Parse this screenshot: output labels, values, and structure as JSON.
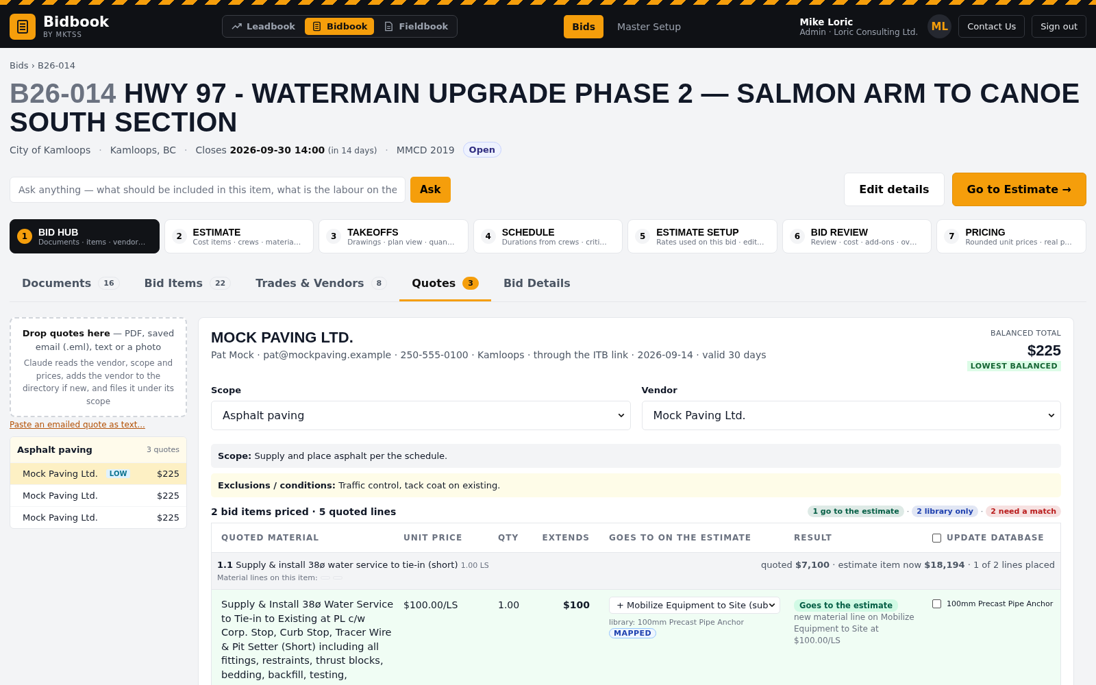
{
  "header": {
    "logo": {
      "name": "Bidbook",
      "sub": "BY MKTSS"
    },
    "apps": [
      {
        "label": "Leadbook",
        "kind": "trend",
        "selected": false
      },
      {
        "label": "Bidbook",
        "kind": "book",
        "selected": true
      },
      {
        "label": "Fieldbook",
        "kind": "doc",
        "selected": false
      }
    ],
    "nav": [
      {
        "label": "Bids",
        "selected": true
      },
      {
        "label": "Master Setup",
        "selected": false
      }
    ],
    "user": {
      "name": "Mike Loric",
      "role": "Admin · Loric Consulting Ltd.",
      "initials": "ML"
    },
    "buttons": [
      "Contact Us",
      "Sign out"
    ]
  },
  "breadcrumb": "Bids › B26-014",
  "title": {
    "code": "B26-014",
    "name": "HWY 97 - WATERMAIN UPGRADE PHASE 2 — SALMON ARM TO CANOE SOUTH SECTION"
  },
  "meta": {
    "client": "City of Kamloops",
    "location": "Kamloops, BC",
    "closes": "Closes **2026-09-30 14:00**",
    "closes_note": "(in 14 days)",
    "standard": "MMCD 2019",
    "status": "Open",
    "separator": "·"
  },
  "ask": {
    "placeholder": "Ask anything — what should be included in this item, what is the labour on the",
    "button": "Ask"
  },
  "actions": [
    {
      "label": "Edit details",
      "kind": "secondary"
    },
    {
      "label": "Go to Estimate →",
      "kind": "primary"
    }
  ],
  "steps": [
    {
      "number": "1",
      "title": "BID HUB",
      "subtitle": "Documents · items · vendor…",
      "selected": true
    },
    {
      "number": "2",
      "title": "ESTIMATE",
      "subtitle": "Cost items · crews · materia…",
      "selected": false
    },
    {
      "number": "3",
      "title": "TAKEOFFS",
      "subtitle": "Drawings · plan view · quan…",
      "selected": false
    },
    {
      "number": "4",
      "title": "SCHEDULE",
      "subtitle": "Durations from crews · criti…",
      "selected": false
    },
    {
      "number": "5",
      "title": "ESTIMATE SETUP",
      "subtitle": "Rates used on this bid · edit…",
      "selected": false
    },
    {
      "number": "6",
      "title": "BID REVIEW",
      "subtitle": "Review · cost · add-ons · ov…",
      "selected": false
    },
    {
      "number": "7",
      "title": "PRICING",
      "subtitle": "Rounded unit prices · real p…",
      "selected": false
    }
  ],
  "tabs": [
    {
      "label": "Documents",
      "count": "16",
      "selected": false
    },
    {
      "label": "Bid Items",
      "count": "22",
      "selected": false
    },
    {
      "label": "Trades & Vendors",
      "count": "8",
      "selected": false
    },
    {
      "label": "Quotes",
      "count": "3",
      "selected": true
    },
    {
      "label": "Bid Details",
      "selected": false
    }
  ],
  "drop": {
    "text": "**Drop quotes here** — PDF, saved email (.eml), text or a photo",
    "note": "Claude reads the vendor, scope and prices, adds the vendor to the directory if new, and files it under its scope",
    "link": "Paste an emailed quote as text..."
  },
  "scope_group": {
    "title": "Asphalt paving",
    "count": "3 quotes",
    "quotes": [
      {
        "vendor": "Mock Paving Ltd.",
        "badge": "LOW",
        "amount": "$225",
        "selected": true
      },
      {
        "vendor": "Mock Paving Ltd.",
        "amount": "$225",
        "selected": false
      },
      {
        "vendor": "Mock Paving Ltd.",
        "amount": "$225",
        "selected": false
      }
    ]
  },
  "quote": {
    "vendor": "MOCK PAVING LTD.",
    "contact": "Pat Mock · pat@mockpaving.example · 250-555-0100 · Kamloops · through the ITB link · 2026-09-14 · valid 30 days",
    "total_label": "BALANCED TOTAL",
    "total": "$225",
    "total_badge": "LOWEST BALANCED",
    "scope_field": {
      "label": "Scope",
      "value": "Asphalt paving"
    },
    "vendor_field": {
      "label": "Vendor",
      "value": "Mock Paving Ltd."
    },
    "scope_note": "**Scope:** Supply and place asphalt per the schedule.",
    "exclusions": "**Exclusions / conditions:** Traffic control, tack coat on existing.",
    "summary": "2 bid items priced · 5 quoted lines",
    "chip_separator": "·",
    "chips": [
      {
        "label": "1 go to the estimate",
        "color": "#065f46"
      },
      {
        "label": "2 library only",
        "color": "#1e40af"
      },
      {
        "label": "2 need a match",
        "color": "#b91c1c"
      }
    ],
    "columns": [
      "QUOTED MATERIAL",
      "UNIT PRICE",
      "QTY",
      "EXTENDS",
      "GOES TO ON THE ESTIMATE",
      "RESULT",
      "UPDATE DATABASE"
    ],
    "update_all": {
      "checked": false
    },
    "item": {
      "title": "**1.1** Supply & install 38ø water service to tie-in (short)",
      "qty": "1.00 LS",
      "materials_label": "Material lines on this item:",
      "totals": "quoted **$7,100** · estimate item now **$18,194** · 1 of 2 lines placed"
    },
    "lines": [
      {
        "material": "Supply & Install 38ø Water Service to Tie-in to Existing at PL c/w Corp. Stop, Curb Stop, Tracer Wire & Pit Setter (Short) including all fittings, restraints, thrust blocks, bedding, backfill, testing,",
        "unit_price": "$100.00/LS",
        "qty": "1.00",
        "extends": "$100",
        "goes_to": "+ Mobilize Equipment to Site (sub",
        "library": "library: 100mm Precast Pipe Anchor",
        "mapped": "MAPPED",
        "result": "Goes to the estimate",
        "result_note": "new material line on Mobilize Equipment to Site at $100.00/LS",
        "update": {
          "checked": false,
          "label": "100mm Precast Pipe Anchor"
        }
      }
    ]
  }
}
